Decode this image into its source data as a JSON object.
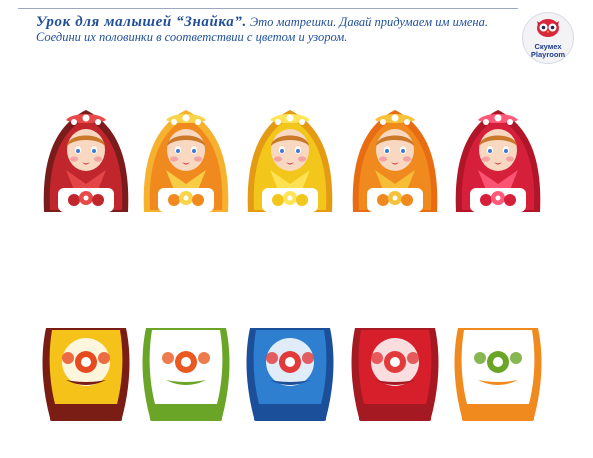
{
  "header": {
    "title_bold": "Урок  для  малышей  “Знайка”.",
    "title_rest": "  Это  матрешки.  Давай  придумаем  им  имена.",
    "subtitle": "Соедини их половинки в соответствии с цветом и узором."
  },
  "logo": {
    "name": "logo-owl-icon",
    "line1": "Скумех",
    "line2": "Playroom"
  },
  "top_halves": [
    {
      "name": "doll-top-1",
      "scarf": "#c0262b",
      "scarf_dark": "#7a1b1c",
      "accent": "#e84a4a"
    },
    {
      "name": "doll-top-2",
      "scarf": "#f08a1e",
      "scarf_dark": "#f6b12e",
      "accent": "#f8d44a"
    },
    {
      "name": "doll-top-3",
      "scarf": "#f2c61b",
      "scarf_dark": "#e49a12",
      "accent": "#ffe45a"
    },
    {
      "name": "doll-top-4",
      "scarf": "#f08a1e",
      "scarf_dark": "#e86c12",
      "accent": "#f6c23a"
    },
    {
      "name": "doll-top-5",
      "scarf": "#d61f3a",
      "scarf_dark": "#b01528",
      "accent": "#ff5a7a"
    }
  ],
  "bottom_halves": [
    {
      "name": "doll-bottom-1",
      "body": "#f4c218",
      "base": "#7a1d14",
      "flower": "#e64a1e"
    },
    {
      "name": "doll-bottom-2",
      "body": "#ffffff",
      "base": "#6aa527",
      "flower": "#e85a22"
    },
    {
      "name": "doll-bottom-3",
      "body": "#2f7fd1",
      "base": "#1b4f9a",
      "flower": "#e23a3a"
    },
    {
      "name": "doll-bottom-4",
      "body": "#d61f2a",
      "base": "#a51a22",
      "flower": "#e23a3a"
    },
    {
      "name": "doll-bottom-5",
      "body": "#ffffff",
      "base": "#f08a1e",
      "flower": "#6aa527"
    }
  ]
}
